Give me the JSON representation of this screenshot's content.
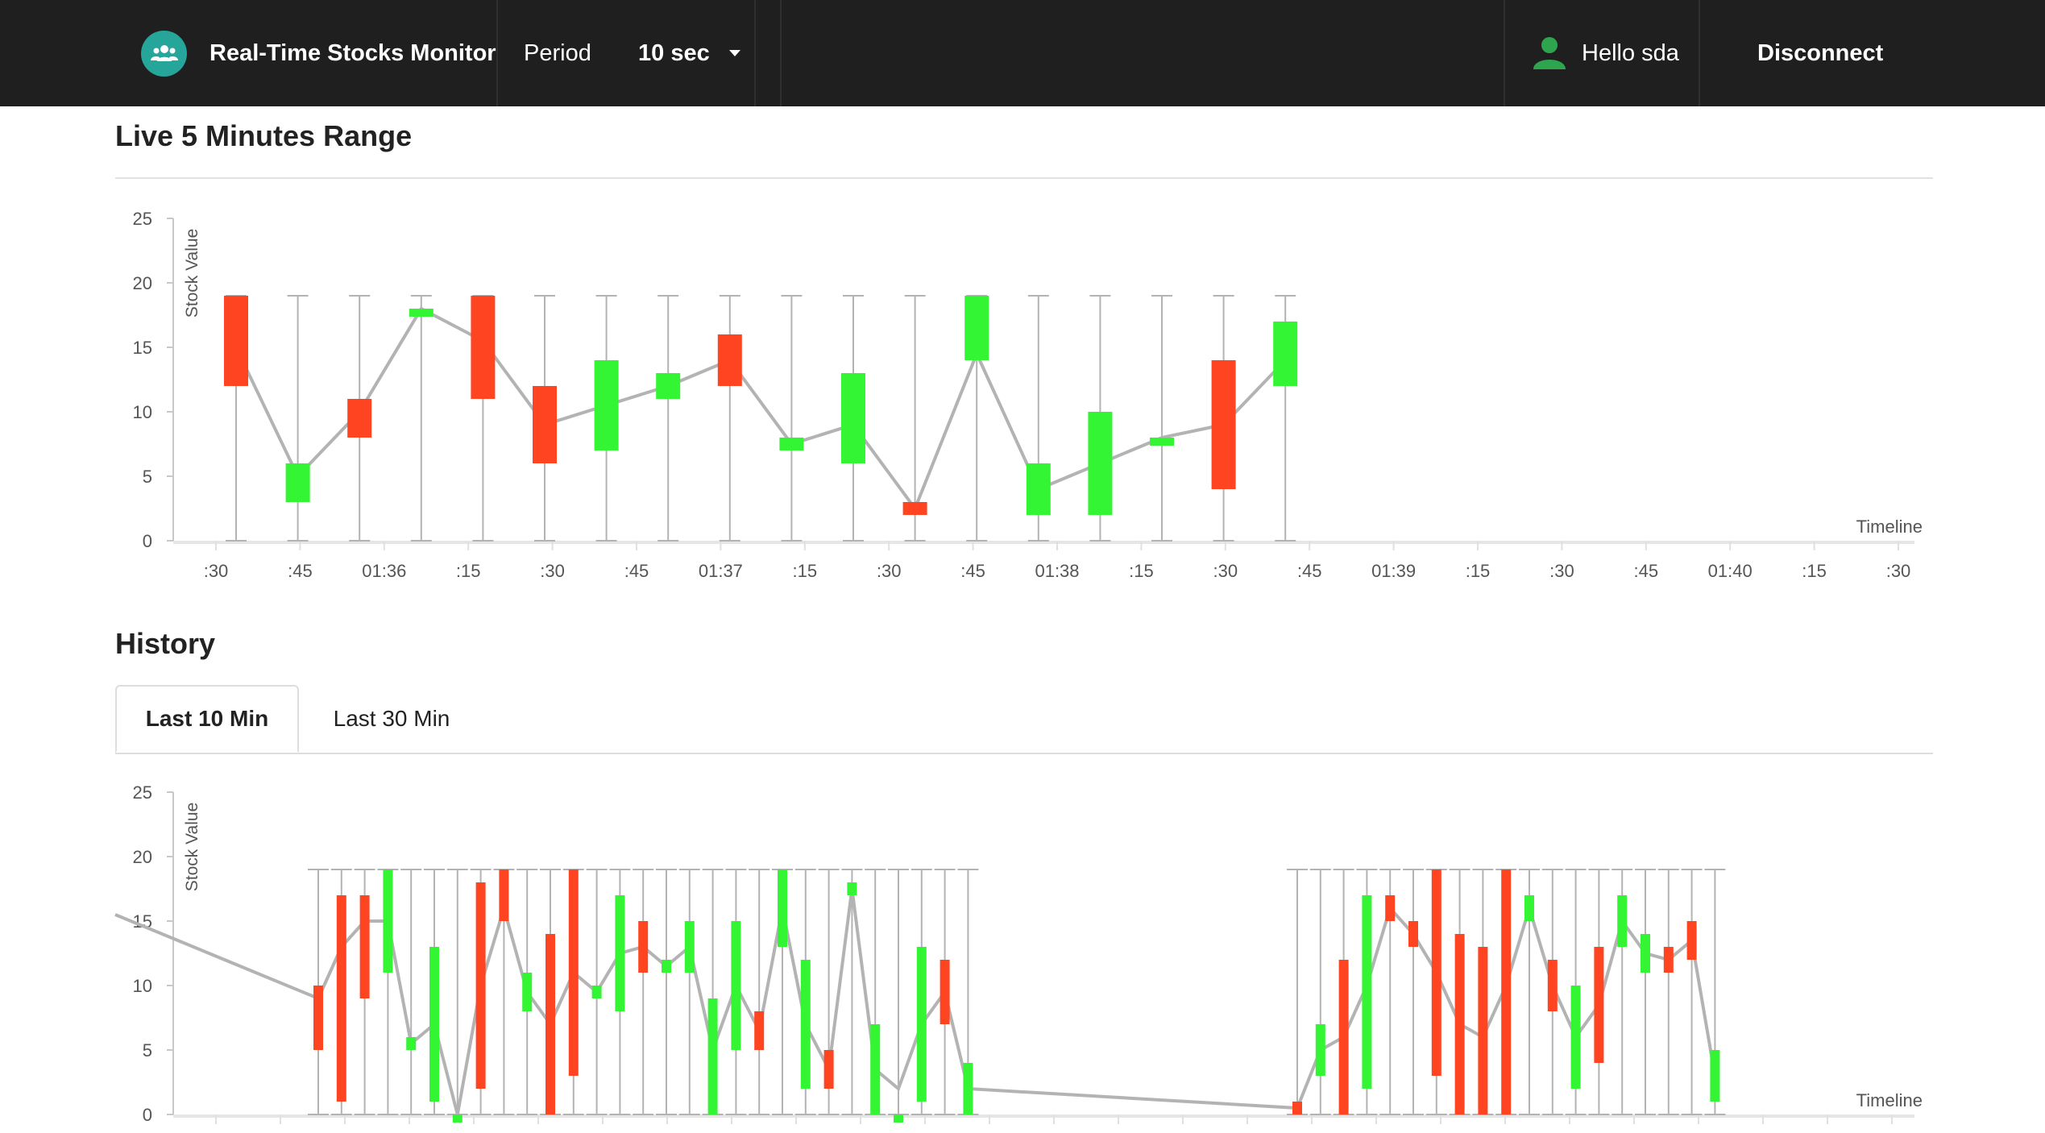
{
  "navbar": {
    "logo_icon": "users-icon",
    "brand": "Real-Time Stocks Monitor",
    "period_label": "Period",
    "period_value": "10 sec",
    "user_icon": "user-icon",
    "greeting": "Hello sda",
    "disconnect": "Disconnect"
  },
  "live_section": {
    "title": "Live 5 Minutes Range"
  },
  "history_section": {
    "title": "History",
    "tabs": [
      {
        "label": "Last 10 Min",
        "active": true
      },
      {
        "label": "Last 30 Min",
        "active": false
      }
    ]
  },
  "colors": {
    "up": "#33f533",
    "down": "#ff4422",
    "line": "#b3b3b3",
    "navbar": "#1f1f1f",
    "brand_icon": "#26a69a",
    "user_icon": "#2ea44f"
  },
  "chart_data": [
    {
      "type": "candlestick",
      "ylabel": "Stock Value",
      "xlabel": "Timeline",
      "ylim": [
        0,
        25
      ],
      "yticks": [
        0,
        5,
        10,
        15,
        20,
        25
      ],
      "x_ticks": [
        ":30",
        ":45",
        "01:36",
        ":15",
        ":30",
        ":45",
        "01:37",
        ":15",
        ":30",
        ":45",
        "01:38",
        ":15",
        ":30",
        ":45",
        "01:39",
        ":15",
        ":30",
        ":45",
        "01:40",
        ":15",
        ":30"
      ],
      "high": 19,
      "low": 0,
      "candles": [
        {
          "open": 19,
          "close": 12,
          "avg": 15
        },
        {
          "open": 3,
          "close": 6,
          "avg": 5
        },
        {
          "open": 11,
          "close": 8,
          "avg": 10
        },
        {
          "open": 18,
          "close": 18,
          "avg": 18
        },
        {
          "open": 19,
          "close": 11,
          "avg": 15.5
        },
        {
          "open": 12,
          "close": 6,
          "avg": 9
        },
        {
          "open": 7,
          "close": 14,
          "avg": 10.5
        },
        {
          "open": 11,
          "close": 13,
          "avg": 12
        },
        {
          "open": 16,
          "close": 12,
          "avg": 14
        },
        {
          "open": 7,
          "close": 8,
          "avg": 7.5
        },
        {
          "open": 6,
          "close": 13,
          "avg": 9
        },
        {
          "open": 3,
          "close": 2,
          "avg": 2.5
        },
        {
          "open": 14,
          "close": 19,
          "avg": 14.5
        },
        {
          "open": 2,
          "close": 6,
          "avg": 4
        },
        {
          "open": 2,
          "close": 10,
          "avg": 6
        },
        {
          "open": 8,
          "close": 8,
          "avg": 8
        },
        {
          "open": 14,
          "close": 4,
          "avg": 9
        },
        {
          "open": 12,
          "close": 17,
          "avg": 14
        }
      ]
    },
    {
      "type": "candlestick",
      "ylabel": "Stock Value",
      "xlabel": "Timeline",
      "ylim": [
        0,
        25
      ],
      "yticks": [
        0,
        5,
        10,
        15,
        20,
        25
      ],
      "high": 19,
      "low": 0,
      "line_start": 15.5,
      "groups": [
        {
          "start_avg": 7.5,
          "candles": [
            {
              "open": 10,
              "close": 5,
              "avg": 9
            },
            {
              "open": 17,
              "close": 1,
              "avg": 13
            },
            {
              "open": 17,
              "close": 9,
              "avg": 15
            },
            {
              "open": 11,
              "close": 19,
              "avg": 15
            },
            {
              "open": 5,
              "close": 6,
              "avg": 5.5
            },
            {
              "open": 1,
              "close": 13,
              "avg": 7
            },
            {
              "open": 0,
              "close": 0,
              "avg": 0
            },
            {
              "open": 18,
              "close": 2,
              "avg": 10
            },
            {
              "open": 19,
              "close": 15,
              "avg": 16
            },
            {
              "open": 8,
              "close": 11,
              "avg": 9.5
            },
            {
              "open": 14,
              "close": 0,
              "avg": 7
            },
            {
              "open": 19,
              "close": 3,
              "avg": 11
            },
            {
              "open": 9,
              "close": 10,
              "avg": 9.5
            },
            {
              "open": 8,
              "close": 17,
              "avg": 12.5
            },
            {
              "open": 15,
              "close": 11,
              "avg": 13
            },
            {
              "open": 11,
              "close": 12,
              "avg": 11.5
            },
            {
              "open": 11,
              "close": 15,
              "avg": 13
            },
            {
              "open": 0,
              "close": 9,
              "avg": 5
            },
            {
              "open": 5,
              "close": 15,
              "avg": 10
            },
            {
              "open": 8,
              "close": 5,
              "avg": 6.5
            },
            {
              "open": 13,
              "close": 19,
              "avg": 16
            },
            {
              "open": 2,
              "close": 12,
              "avg": 7
            },
            {
              "open": 5,
              "close": 2,
              "avg": 3.5
            },
            {
              "open": 17,
              "close": 18,
              "avg": 17.5
            },
            {
              "open": 0,
              "close": 7,
              "avg": 3.5
            },
            {
              "open": 0,
              "close": 0,
              "avg": 2
            },
            {
              "open": 1,
              "close": 13,
              "avg": 7
            },
            {
              "open": 12,
              "close": 7,
              "avg": 9.5
            },
            {
              "open": 0,
              "close": 4,
              "avg": 2
            }
          ],
          "end_avg": 1
        },
        {
          "start_avg": 0.5,
          "candles": [
            {
              "open": 1,
              "close": 0,
              "avg": 0.5
            },
            {
              "open": 3,
              "close": 7,
              "avg": 5
            },
            {
              "open": 12,
              "close": 0,
              "avg": 6
            },
            {
              "open": 2,
              "close": 17,
              "avg": 10
            },
            {
              "open": 17,
              "close": 15,
              "avg": 16
            },
            {
              "open": 15,
              "close": 13,
              "avg": 14
            },
            {
              "open": 19,
              "close": 3,
              "avg": 11
            },
            {
              "open": 14,
              "close": 0,
              "avg": 7
            },
            {
              "open": 13,
              "close": 0,
              "avg": 6
            },
            {
              "open": 19,
              "close": 0,
              "avg": 10
            },
            {
              "open": 15,
              "close": 17,
              "avg": 16
            },
            {
              "open": 12,
              "close": 8,
              "avg": 10
            },
            {
              "open": 2,
              "close": 10,
              "avg": 6
            },
            {
              "open": 13,
              "close": 4,
              "avg": 8.5
            },
            {
              "open": 13,
              "close": 17,
              "avg": 15
            },
            {
              "open": 11,
              "close": 14,
              "avg": 12.5
            },
            {
              "open": 13,
              "close": 11,
              "avg": 12
            },
            {
              "open": 15,
              "close": 12,
              "avg": 13.5
            },
            {
              "open": 1,
              "close": 5,
              "avg": 3
            }
          ]
        }
      ]
    }
  ]
}
